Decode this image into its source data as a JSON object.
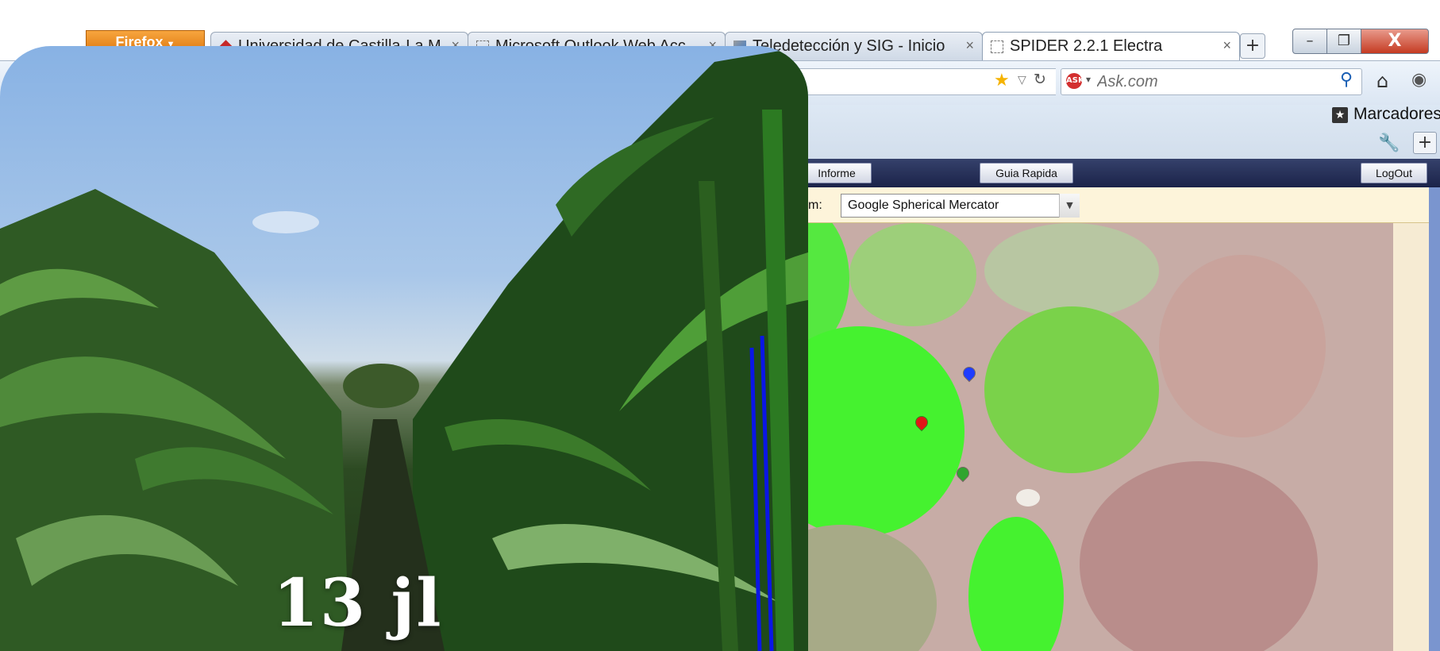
{
  "browser": {
    "menu_button": "Firefox",
    "tabs": [
      {
        "title": "Universidad de Castilla-La M...",
        "close": "×"
      },
      {
        "title": "Microsoft Outlook Web Acc...",
        "close": "×"
      },
      {
        "title": "Teledetección y SIG - Inicio",
        "close": "×"
      },
      {
        "title": "SPIDER 2.2.1 Electra",
        "close": "×"
      }
    ],
    "new_tab": "+",
    "window_controls": {
      "minimize": "–",
      "maximize": "❐",
      "close": "X"
    },
    "search": {
      "engine_icon": "ask-logo-icon",
      "placeholder": "Ask.com"
    },
    "bookmarks_label": "Marcadores",
    "add_button": "+"
  },
  "app": {
    "toolbar": {
      "informe": "Informe",
      "guia": "Guia Rapida",
      "logout": "LogOut"
    },
    "projection": {
      "label": "m:",
      "value": "Google Spherical Mercator"
    }
  },
  "map": {
    "markers": [
      {
        "color": "#1f3cff"
      },
      {
        "color": "#e01818"
      },
      {
        "color": "#2fa52f"
      }
    ]
  },
  "photo": {
    "caption": "13 jl"
  },
  "colors": {
    "field_green": "#45f22f",
    "navbar_dark": "#1b2349",
    "toolbar_cream": "#fdf4da"
  }
}
